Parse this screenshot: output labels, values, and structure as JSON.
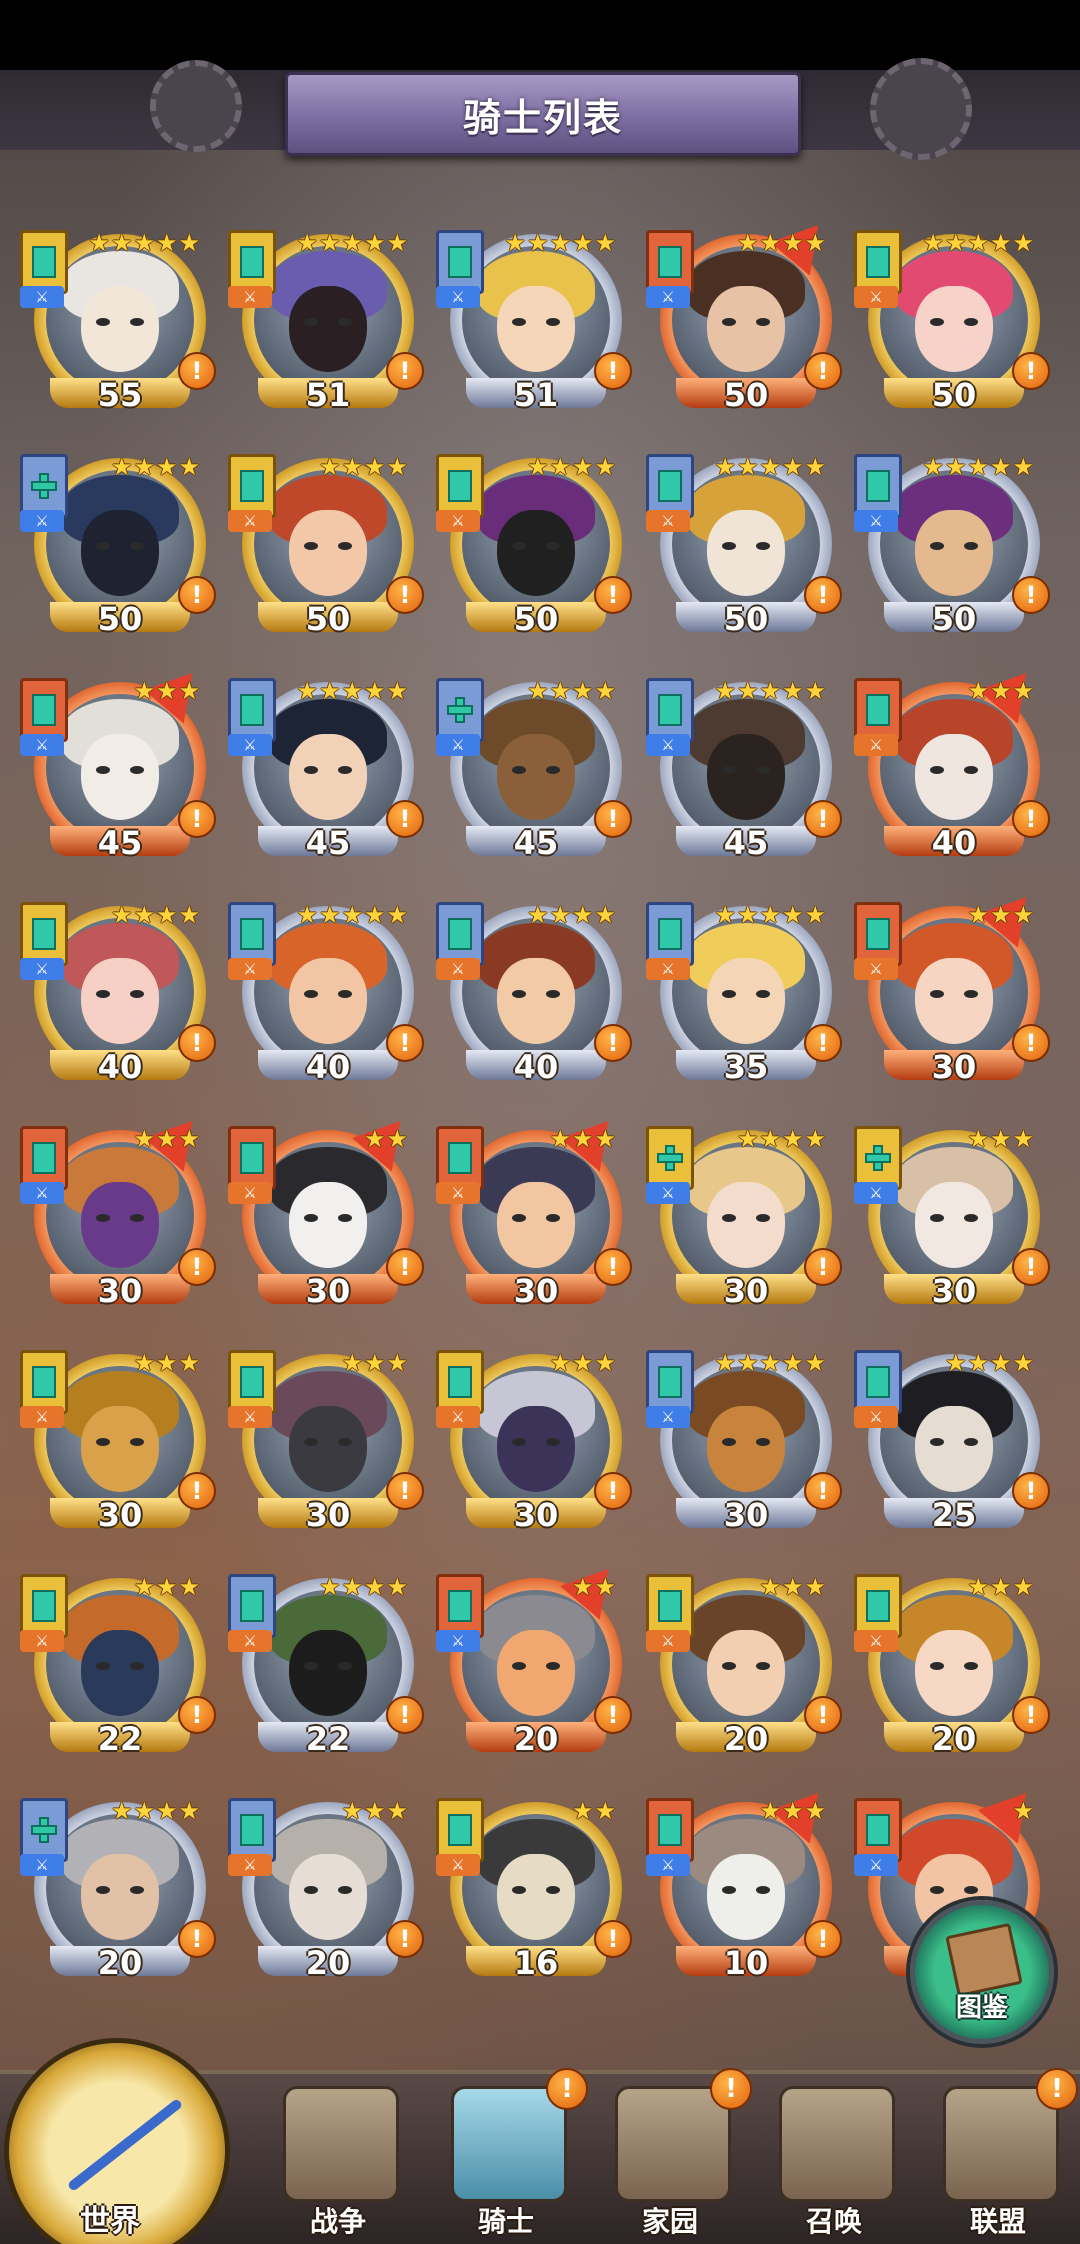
{
  "header": {
    "title": "骑士列表"
  },
  "knights": [
    {
      "level": "55",
      "stars": 5,
      "frame": "gold",
      "badge": "gold",
      "cls": "blue",
      "shape": "rect",
      "rank": false,
      "skin": "#f2e6d8",
      "hair": "#e9e6e2"
    },
    {
      "level": "51",
      "stars": 5,
      "frame": "gold",
      "badge": "gold",
      "cls": "orange",
      "shape": "rect",
      "rank": false,
      "skin": "#2a2024",
      "hair": "#6a5db0"
    },
    {
      "level": "51",
      "stars": 5,
      "frame": "silver",
      "badge": "blue",
      "cls": "blue",
      "shape": "rect",
      "rank": false,
      "skin": "#f6d6b8",
      "hair": "#e8c24a"
    },
    {
      "level": "50",
      "stars": 4,
      "frame": "red",
      "badge": "red",
      "cls": "blue",
      "shape": "rect",
      "rank": true,
      "skin": "#e7c2a4",
      "hair": "#4a3022"
    },
    {
      "level": "50",
      "stars": 5,
      "frame": "gold",
      "badge": "gold",
      "cls": "orange",
      "shape": "rect",
      "rank": false,
      "skin": "#f6d2c8",
      "hair": "#e24a72"
    },
    {
      "level": "50",
      "stars": 4,
      "frame": "gold",
      "badge": "blue",
      "cls": "blue",
      "shape": "cross",
      "rank": false,
      "skin": "#1f2230",
      "hair": "#2a3a5e"
    },
    {
      "level": "50",
      "stars": 4,
      "frame": "gold",
      "badge": "gold",
      "cls": "orange",
      "shape": "rect",
      "rank": false,
      "skin": "#f2c8a8",
      "hair": "#c0482a"
    },
    {
      "level": "50",
      "stars": 4,
      "frame": "gold",
      "badge": "gold",
      "cls": "orange",
      "shape": "rect",
      "rank": false,
      "skin": "#202020",
      "hair": "#6a2d7a"
    },
    {
      "level": "50",
      "stars": 5,
      "frame": "silver",
      "badge": "blue",
      "cls": "orange",
      "shape": "rect",
      "rank": false,
      "skin": "#efe4d6",
      "hair": "#d8a23a"
    },
    {
      "level": "50",
      "stars": 5,
      "frame": "silver",
      "badge": "blue",
      "cls": "blue",
      "shape": "rect",
      "rank": false,
      "skin": "#e5b98e",
      "hair": "#6b2f7e"
    },
    {
      "level": "45",
      "stars": 3,
      "frame": "red",
      "badge": "red",
      "cls": "blue",
      "shape": "rect",
      "rank": true,
      "skin": "#f1ece6",
      "hair": "#e2ded8"
    },
    {
      "level": "45",
      "stars": 5,
      "frame": "silver",
      "badge": "blue",
      "cls": "blue",
      "shape": "rect",
      "rank": false,
      "skin": "#f1d2b6",
      "hair": "#1c2436"
    },
    {
      "level": "45",
      "stars": 4,
      "frame": "silver",
      "badge": "blue",
      "cls": "blue",
      "shape": "cross",
      "rank": false,
      "skin": "#8a5f3a",
      "hair": "#6c4a2a"
    },
    {
      "level": "45",
      "stars": 5,
      "frame": "silver",
      "badge": "blue",
      "cls": "blue",
      "shape": "rect",
      "rank": false,
      "skin": "#2b2320",
      "hair": "#4d3a30"
    },
    {
      "level": "40",
      "stars": 3,
      "frame": "red",
      "badge": "red",
      "cls": "orange",
      "shape": "rect",
      "rank": true,
      "skin": "#efe6e0",
      "hair": "#b8442a"
    },
    {
      "level": "40",
      "stars": 4,
      "frame": "gold",
      "badge": "gold",
      "cls": "blue",
      "shape": "rect",
      "rank": false,
      "skin": "#f6d0c4",
      "hair": "#c0585a"
    },
    {
      "level": "40",
      "stars": 5,
      "frame": "silver",
      "badge": "blue",
      "cls": "orange",
      "shape": "rect",
      "rank": false,
      "skin": "#f2c6a4",
      "hair": "#d9642a"
    },
    {
      "level": "40",
      "stars": 4,
      "frame": "silver",
      "badge": "blue",
      "cls": "orange",
      "shape": "rect",
      "rank": false,
      "skin": "#f2caa6",
      "hair": "#8a3a22"
    },
    {
      "level": "35",
      "stars": 5,
      "frame": "silver",
      "badge": "blue",
      "cls": "orange",
      "shape": "rect",
      "rank": false,
      "skin": "#f4d6b6",
      "hair": "#f0cc5a"
    },
    {
      "level": "30",
      "stars": 3,
      "frame": "red",
      "badge": "red",
      "cls": "orange",
      "shape": "rect",
      "rank": true,
      "skin": "#f6d6c2",
      "hair": "#d2582a"
    },
    {
      "level": "30",
      "stars": 3,
      "frame": "red",
      "badge": "red",
      "cls": "blue",
      "shape": "rect",
      "rank": true,
      "skin": "#6a3a8a",
      "hair": "#c97a3a"
    },
    {
      "level": "30",
      "stars": 2,
      "frame": "red",
      "badge": "red",
      "cls": "orange",
      "shape": "rect",
      "rank": true,
      "skin": "#f2f0ee",
      "hair": "#2a2a2e"
    },
    {
      "level": "30",
      "stars": 3,
      "frame": "red",
      "badge": "red",
      "cls": "orange",
      "shape": "rect",
      "rank": true,
      "skin": "#f2c6a0",
      "hair": "#3a3a54"
    },
    {
      "level": "30",
      "stars": 4,
      "frame": "gold",
      "badge": "gold",
      "cls": "blue",
      "shape": "cross",
      "rank": false,
      "skin": "#f4dccc",
      "hair": "#e8c88a"
    },
    {
      "level": "30",
      "stars": 3,
      "frame": "gold",
      "badge": "gold",
      "cls": "blue",
      "shape": "cross",
      "rank": false,
      "skin": "#f2e8e2",
      "hair": "#d8c0a6"
    },
    {
      "level": "30",
      "stars": 3,
      "frame": "gold",
      "badge": "gold",
      "cls": "orange",
      "shape": "rect",
      "rank": false,
      "skin": "#d9a24a",
      "hair": "#b57f20"
    },
    {
      "level": "30",
      "stars": 3,
      "frame": "gold",
      "badge": "gold",
      "cls": "orange",
      "shape": "rect",
      "rank": false,
      "skin": "#3a3a40",
      "hair": "#6a4a5a"
    },
    {
      "level": "30",
      "stars": 3,
      "frame": "gold",
      "badge": "gold",
      "cls": "orange",
      "shape": "rect",
      "rank": false,
      "skin": "#3c3458",
      "hair": "#c6c6d4"
    },
    {
      "level": "30",
      "stars": 5,
      "frame": "silver",
      "badge": "blue",
      "cls": "blue",
      "shape": "rect",
      "rank": false,
      "skin": "#c8843c",
      "hair": "#7a4a24"
    },
    {
      "level": "25",
      "stars": 4,
      "frame": "silver",
      "badge": "blue",
      "cls": "orange",
      "shape": "rect",
      "rank": false,
      "skin": "#e6ddd2",
      "hair": "#1e1e22"
    },
    {
      "level": "22",
      "stars": 3,
      "frame": "gold",
      "badge": "gold",
      "cls": "orange",
      "shape": "rect",
      "rank": false,
      "skin": "#2a3a5a",
      "hair": "#c46a2a"
    },
    {
      "level": "22",
      "stars": 4,
      "frame": "silver",
      "badge": "blue",
      "cls": "orange",
      "shape": "rect",
      "rank": false,
      "skin": "#1c1c1c",
      "hair": "#4a6a3a"
    },
    {
      "level": "20",
      "stars": 2,
      "frame": "red",
      "badge": "red",
      "cls": "blue",
      "shape": "rect",
      "rank": true,
      "skin": "#f0a870",
      "hair": "#8a8a90"
    },
    {
      "level": "20",
      "stars": 3,
      "frame": "gold",
      "badge": "gold",
      "cls": "orange",
      "shape": "rect",
      "rank": false,
      "skin": "#f2cfb0",
      "hair": "#6a4428"
    },
    {
      "level": "20",
      "stars": 3,
      "frame": "gold",
      "badge": "gold",
      "cls": "orange",
      "shape": "rect",
      "rank": false,
      "skin": "#f6d8c4",
      "hair": "#c8862a"
    },
    {
      "level": "20",
      "stars": 4,
      "frame": "silver",
      "badge": "blue",
      "cls": "blue",
      "shape": "cross",
      "rank": false,
      "skin": "#e2c2a6",
      "hair": "#b2b2b6"
    },
    {
      "level": "20",
      "stars": 3,
      "frame": "silver",
      "badge": "blue",
      "cls": "orange",
      "shape": "rect",
      "rank": false,
      "skin": "#e6ded4",
      "hair": "#b6b0aa"
    },
    {
      "level": "16",
      "stars": 2,
      "frame": "gold",
      "badge": "gold",
      "cls": "orange",
      "shape": "rect",
      "rank": false,
      "skin": "#e6dcc6",
      "hair": "#3a3a3a"
    },
    {
      "level": "10",
      "stars": 3,
      "frame": "red",
      "badge": "red",
      "cls": "blue",
      "shape": "rect",
      "rank": true,
      "skin": "#eeeeea",
      "hair": "#9a8a80"
    },
    {
      "level": "",
      "stars": 1,
      "frame": "red",
      "badge": "red",
      "cls": "blue",
      "shape": "rect",
      "rank": true,
      "skin": "#f2c4a4",
      "hair": "#d2482a"
    }
  ],
  "codex": {
    "label": "图鉴",
    "icon": "book-icon"
  },
  "nav": {
    "world": "世界",
    "war": "战争",
    "knights": "骑士",
    "home": "家园",
    "summon": "召唤",
    "alliance": "联盟",
    "alert_mark": "!"
  },
  "colors": {
    "star": "#ffd43a",
    "alert": "#e2620c",
    "title_plate": "#7d6ea3"
  }
}
